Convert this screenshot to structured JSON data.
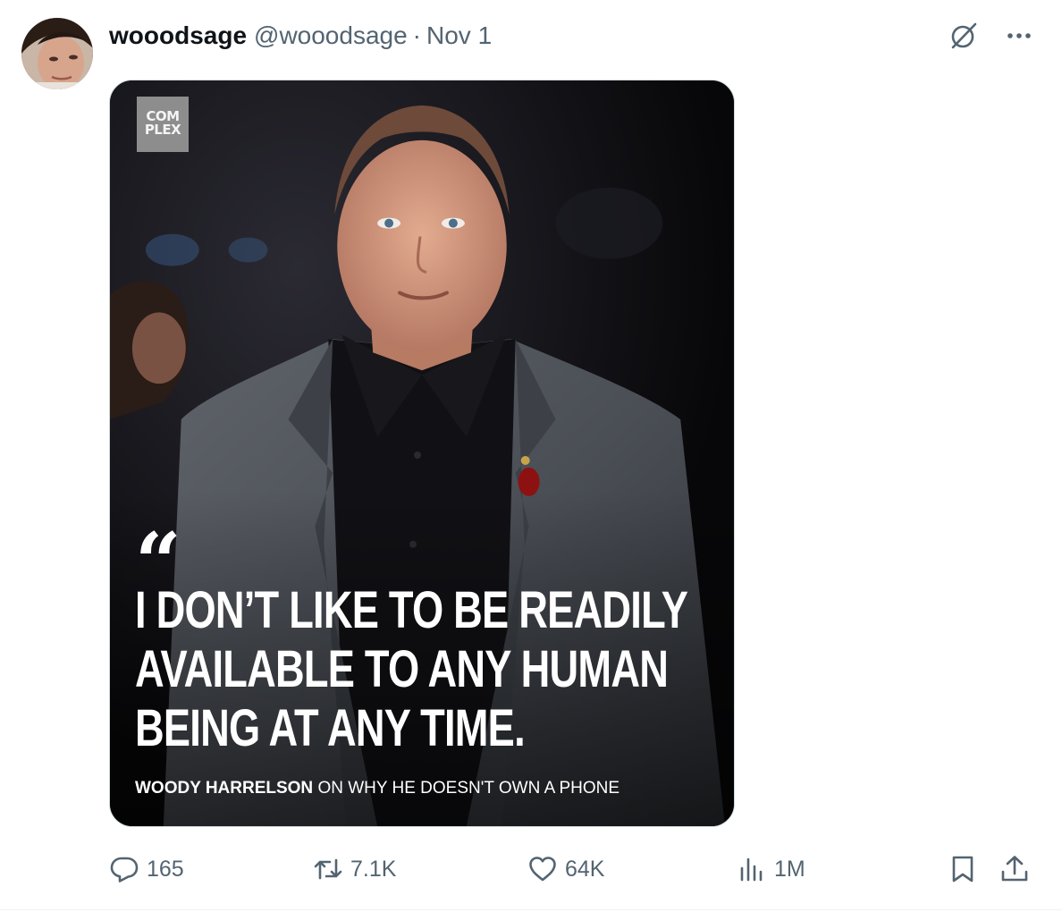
{
  "tweet": {
    "display_name": "wooodsage",
    "handle": "@wooodsage",
    "separator": "·",
    "date": "Nov 1",
    "avatar_icon": "avatar-photo",
    "top_icons": [
      "grok-icon",
      "more-icon"
    ]
  },
  "media": {
    "logo_lines": [
      "COM",
      "PLEX"
    ],
    "quote_mark": "“",
    "quote_lines": [
      "I DON’T LIKE TO BE READILY",
      "AVAILABLE TO ANY HUMAN",
      "BEING AT ANY TIME."
    ],
    "attribution_name": "WOODY HARRELSON",
    "attribution_rest": " ON WHY HE DOESN'T OWN A PHONE"
  },
  "actions": {
    "replies": "165",
    "reposts": "7.1K",
    "likes": "64K",
    "views": "1M",
    "icons": [
      "reply-icon",
      "repost-icon",
      "like-icon",
      "views-icon",
      "bookmark-icon",
      "share-icon"
    ]
  },
  "colors": {
    "text_primary": "#0f1419",
    "text_secondary": "#536471",
    "border": "#cfd9de"
  }
}
